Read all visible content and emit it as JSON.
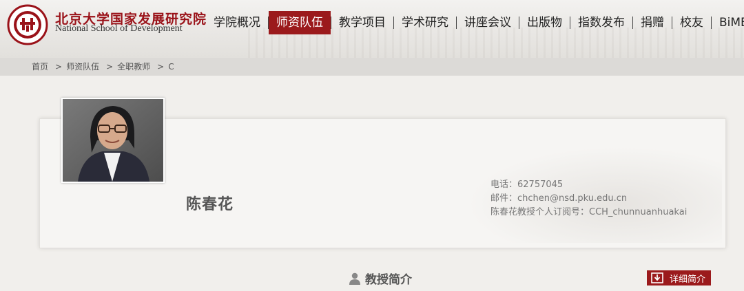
{
  "header": {
    "school_name_cn": "北京大学国家发展研究院",
    "school_name_en": "National School of Development",
    "logo_text": "PEKING UNIVERSITY 1898"
  },
  "nav": {
    "items": [
      {
        "label": "学院概况",
        "active": false
      },
      {
        "label": "师资队伍",
        "active": true
      },
      {
        "label": "教学项目",
        "active": false
      },
      {
        "label": "学术研究",
        "active": false
      },
      {
        "label": "讲座会议",
        "active": false
      },
      {
        "label": "出版物",
        "active": false
      },
      {
        "label": "指数发布",
        "active": false
      },
      {
        "label": "捐赠",
        "active": false
      },
      {
        "label": "校友",
        "active": false
      },
      {
        "label": "BiMBA",
        "active": false
      }
    ]
  },
  "breadcrumb": {
    "home": "首页",
    "level1": "师资队伍",
    "level2": "全职教师",
    "current": "C",
    "separator": ">"
  },
  "profile": {
    "name": "陈春花",
    "phone": "电话：62757045",
    "email": "邮件：chchen@nsd.pku.edu.cn",
    "subscription": "陈春花教授个人订阅号：CCH_chunnuanhuakai"
  },
  "section": {
    "title": "教授简介",
    "detail_button": "详细简介"
  },
  "colors": {
    "brand_red": "#9b1a1c",
    "crumb_bar": "#dcdad7"
  }
}
